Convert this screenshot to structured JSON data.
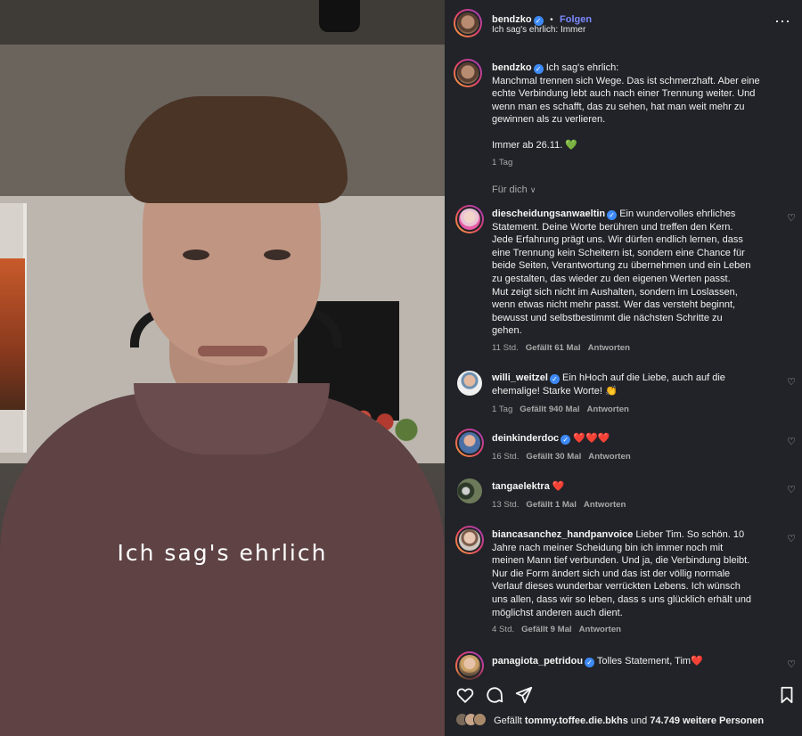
{
  "video": {
    "caption": "Ich sag's ehrlich"
  },
  "header": {
    "username": "bendzko",
    "separator": "•",
    "follow_label": "Folgen",
    "subtitle": "Ich sag's ehrlich: Immer",
    "more_icon": "⋯"
  },
  "post": {
    "username": "bendzko",
    "text_lines": [
      "Ich sag's ehrlich:",
      "Manchmal trennen sich Wege. Das ist schmerzhaft. Aber eine",
      "echte Verbindung lebt auch nach einer Trennung weiter. Und",
      "wenn man es schafft, das zu sehen, hat man weit mehr zu",
      "gewinnen als zu verlieren."
    ],
    "release_line": "Immer ab 26.11. 💚",
    "time": "1 Tag"
  },
  "sort_label": "Für dich",
  "comments": [
    {
      "username": "diescheidungsanwaeltin",
      "verified": true,
      "lines": [
        "Ein wundervolles ehrliches",
        "Statement. Deine Worte berühren und treffen den Kern.",
        "Jede Erfahrung prägt uns. Wir dürfen endlich lernen, dass",
        "eine Trennung kein Scheitern ist, sondern eine Chance für",
        "beide Seiten, Verantwortung zu übernehmen und ein Leben",
        "zu gestalten, das wieder zu den eigenen Werten passt.",
        "Mut zeigt sich nicht im Aushalten, sondern im Loslassen,",
        "wenn etwas nicht mehr passt. Wer das versteht beginnt,",
        "bewusst und selbstbestimmt die nächsten Schritte zu",
        "gehen."
      ],
      "time": "11 Std.",
      "likes": "Gefällt 61 Mal",
      "reply": "Antworten"
    },
    {
      "username": "willi_weitzel",
      "verified": true,
      "lines": [
        "Ein hHoch auf die Liebe, auch auf die",
        "ehemalige! Starke Worte! 👏"
      ],
      "time": "1 Tag",
      "likes": "Gefällt 940 Mal",
      "reply": "Antworten"
    },
    {
      "username": "deinkinderdoc",
      "verified": true,
      "lines": [
        "❤️❤️❤️"
      ],
      "time": "16 Std.",
      "likes": "Gefällt 30 Mal",
      "reply": "Antworten"
    },
    {
      "username": "tangaelektra",
      "verified": false,
      "lines": [
        "❤️"
      ],
      "time": "13 Std.",
      "likes": "Gefällt 1 Mal",
      "reply": "Antworten"
    },
    {
      "username": "biancasanchez_handpanvoice",
      "verified": false,
      "lines": [
        "Lieber Tim. So schön. 10",
        "Jahre nach meiner Scheidung bin ich immer noch mit",
        "meinen Mann tief verbunden. Und ja, die Verbindung bleibt.",
        "Nur die Form ändert sich und das ist der völlig normale",
        "Verlauf dieses wunderbar verrückten Lebens. Ich wünsch",
        "uns allen, dass wir so leben, dass s uns glücklich erhält und",
        "möglichst anderen auch dient."
      ],
      "time": "4 Std.",
      "likes": "Gefällt 9 Mal",
      "reply": "Antworten"
    },
    {
      "username": "panagiota_petridou",
      "verified": true,
      "lines": [
        "Tolles Statement, Tim❤️"
      ],
      "time": "",
      "likes": "",
      "reply": ""
    }
  ],
  "footer": {
    "liked_prefix": "Gefällt",
    "liked_user": "tommy.toffee.die.bkhs",
    "liked_and": "und",
    "liked_count": "74.749 weitere Personen"
  },
  "colors": {
    "panel_bg": "#212328",
    "link_blue": "#7b89ff",
    "verified_blue": "#3d8af7",
    "meta_gray": "#a8a8a8"
  }
}
